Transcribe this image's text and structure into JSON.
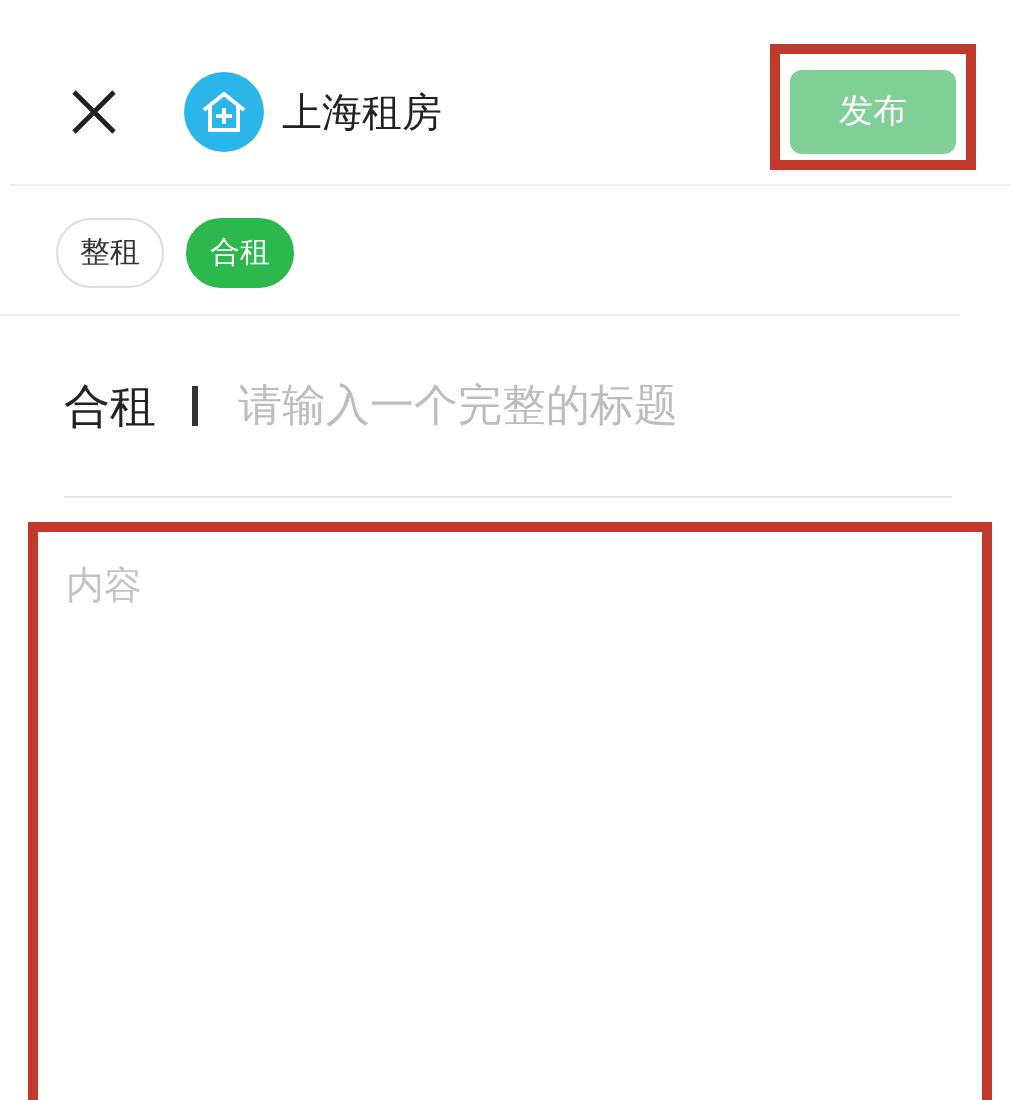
{
  "header": {
    "title": "上海租房",
    "publish_button": {
      "label": "发布",
      "disabled": true
    }
  },
  "tags": [
    {
      "label": "整租",
      "selected": false
    },
    {
      "label": "合租",
      "selected": true
    }
  ],
  "title_field": {
    "prefix": "合租",
    "placeholder": "请输入一个完整的标题"
  },
  "content_field": {
    "placeholder": "内容"
  }
}
